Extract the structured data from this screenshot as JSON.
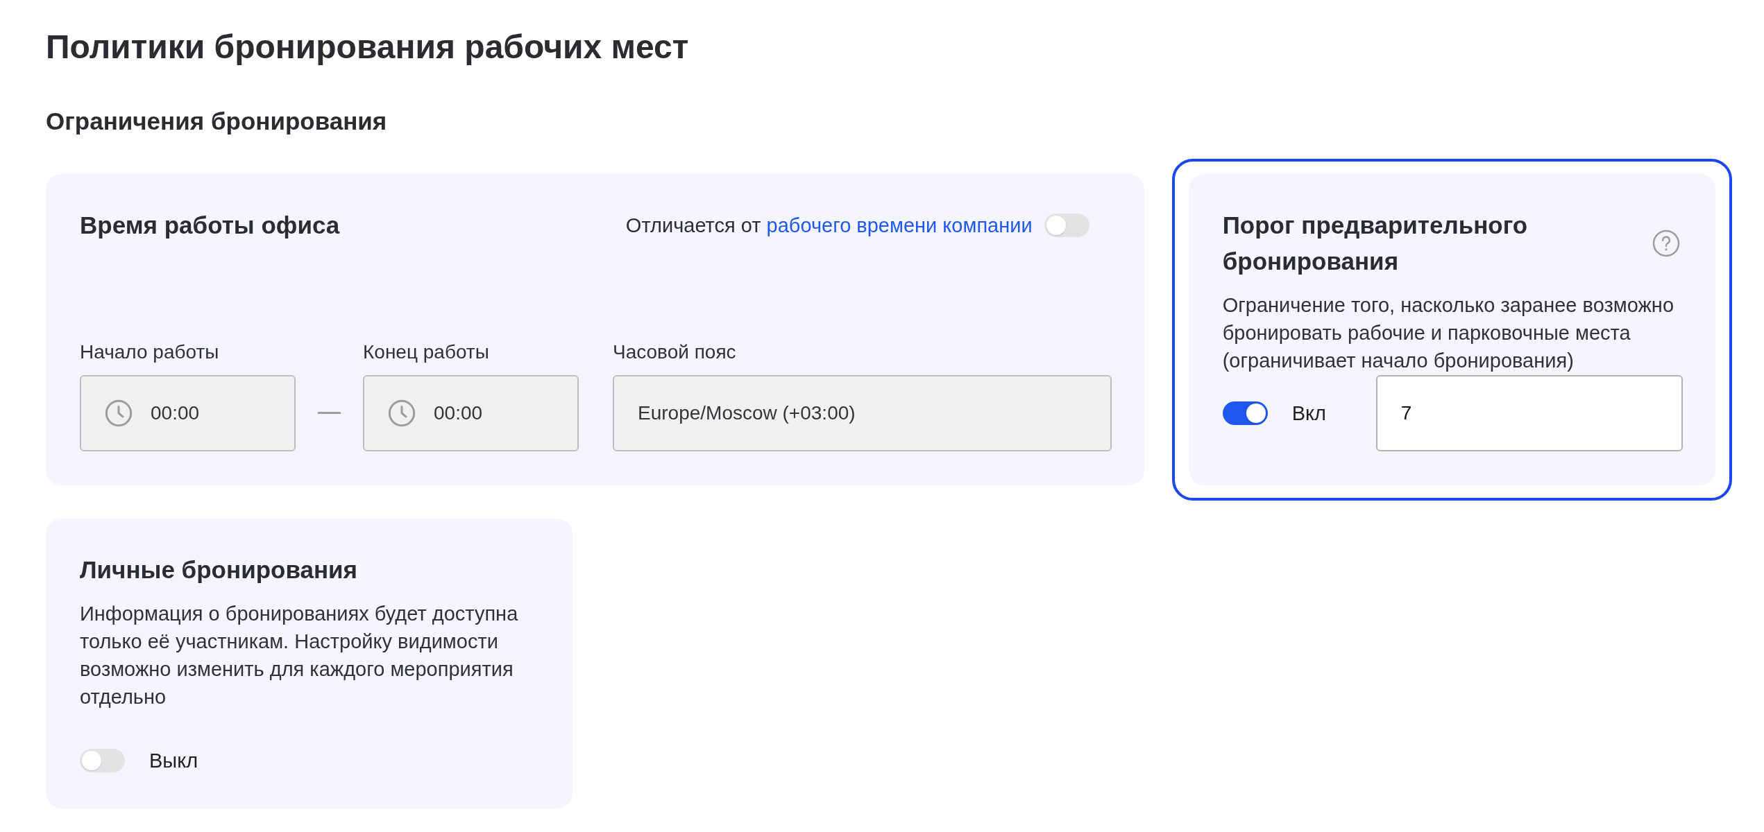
{
  "page": {
    "title": "Политики бронирования рабочих мест",
    "section_title": "Ограничения бронирования"
  },
  "cards": [
    {
      "kind": "office_hours",
      "title": "Время работы офиса",
      "focused": false,
      "override": {
        "text": "Отличается от",
        "link": "рабочего времени компании",
        "on": false
      },
      "fields": [
        {
          "kind": "time",
          "label": "Начало работы",
          "value": "00:00",
          "disabled": true
        },
        {
          "kind": "time",
          "label": "Конец работы",
          "value": "00:00",
          "disabled": true
        },
        {
          "kind": "timezone",
          "label": "Часовой пояс",
          "value": "Europe/Moscow (+03:00)",
          "disabled": true
        }
      ]
    },
    {
      "kind": "threshold",
      "title": "Порог предварительного бронирования",
      "focused": true,
      "description": "Ограничение того, насколько заранее возможно бронировать рабочие и парковочные места (ограничивает начало бронирования)",
      "toggle": {
        "on": true,
        "label": "Вкл"
      },
      "input": {
        "value": "7",
        "disabled": false
      }
    },
    {
      "kind": "personal",
      "title": "Личные бронирования",
      "focused": false,
      "description": "Информация о бронированиях будет доступна только её участникам. Настройку видимости возможно изменить для каждого мероприятия отдельно",
      "toggle": {
        "on": false,
        "label": "Выкл"
      }
    }
  ]
}
